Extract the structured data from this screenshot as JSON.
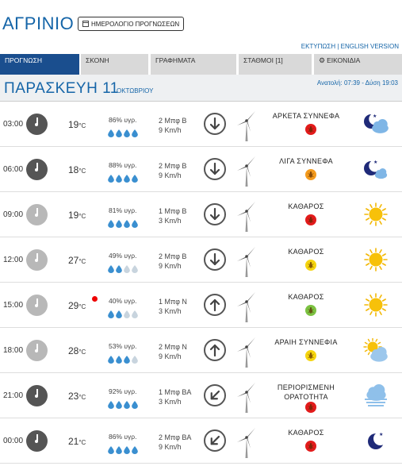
{
  "header": {
    "city": "ΑΓΡΙΝΙΟ",
    "calendar_button": "ΗΜΕΡΟΛΟΓΙΟ ΠΡΟΓΝΩΣΕΩΝ",
    "print_link": "ΕΚΤΥΠΩΣΗ",
    "separator": " | ",
    "english_link": "ENGLISH VERSION"
  },
  "tabs": [
    {
      "label": "ΠΡΟΓΝΩΣΗ",
      "active": true
    },
    {
      "label": "ΣΚΟΝΗ",
      "active": false
    },
    {
      "label": "ΓΡΑΦΗΜΑΤΑ",
      "active": false
    },
    {
      "label": "ΣΤΑΘΜΟΙ [1]",
      "active": false
    },
    {
      "label": "ΕΙΚΟΝΙΔΙΑ",
      "active": false
    }
  ],
  "date_bar": {
    "day": "ΠΑΡΑΣΚΕΥΗ 11",
    "month": "ΟΚΤΩΒΡΙΟΥ",
    "sun_times": "Ανατολή: 07:39 - Δύση 19:03"
  },
  "colors": {
    "accent": "#1565a8",
    "active_tab": "#1a4e8e",
    "tab_bg": "#d9d9d9",
    "drop_full": "#3a8fd0",
    "drop_empty": "#c8d4de",
    "bug_red": "#e21b1b",
    "bug_orange": "#f39a1d",
    "bug_yellow": "#f5d40f",
    "bug_green": "#7cc242"
  },
  "rows": [
    {
      "time": "03:00",
      "clock": "dark",
      "temp": "19",
      "unit": "°C",
      "hot": false,
      "humidity": "86% υγρ.",
      "drops": 4,
      "wind_force": "2 Μπφ Β",
      "wind_speed": "9 Km/h",
      "arrow": "down",
      "condition": "ΑΡΚΕΤΑ ΣΥΝΝΕΦΑ",
      "bug": "red",
      "icon": "moon-cloud-icon"
    },
    {
      "time": "06:00",
      "clock": "dark",
      "temp": "18",
      "unit": "°C",
      "hot": false,
      "humidity": "88% υγρ.",
      "drops": 4,
      "wind_force": "2 Μπφ Β",
      "wind_speed": "9 Km/h",
      "arrow": "down",
      "condition": "ΛΙΓΑ ΣΥΝΝΕΦΑ",
      "bug": "orange",
      "icon": "moon-small-cloud-icon"
    },
    {
      "time": "09:00",
      "clock": "light",
      "temp": "19",
      "unit": "°C",
      "hot": false,
      "humidity": "81% υγρ.",
      "drops": 4,
      "wind_force": "1 Μπφ Β",
      "wind_speed": "3 Km/h",
      "arrow": "down",
      "condition": "ΚΑΘΑΡΟΣ",
      "bug": "red",
      "icon": "sun-icon"
    },
    {
      "time": "12:00",
      "clock": "light",
      "temp": "27",
      "unit": "°C",
      "hot": false,
      "humidity": "49% υγρ.",
      "drops": 2,
      "wind_force": "2 Μπφ Β",
      "wind_speed": "9 Km/h",
      "arrow": "down",
      "condition": "ΚΑΘΑΡΟΣ",
      "bug": "yellow",
      "icon": "sun-icon"
    },
    {
      "time": "15:00",
      "clock": "light",
      "temp": "29",
      "unit": "°C",
      "hot": true,
      "humidity": "40% υγρ.",
      "drops": 2,
      "wind_force": "1 Μπφ Ν",
      "wind_speed": "3 Km/h",
      "arrow": "up",
      "condition": "ΚΑΘΑΡΟΣ",
      "bug": "green",
      "icon": "sun-icon"
    },
    {
      "time": "18:00",
      "clock": "light",
      "temp": "28",
      "unit": "°C",
      "hot": false,
      "humidity": "53% υγρ.",
      "drops": 3,
      "wind_force": "2 Μπφ Ν",
      "wind_speed": "9 Km/h",
      "arrow": "up",
      "condition": "ΑΡΑΙΗ ΣΥΝΝΕΦΙΑ",
      "bug": "yellow",
      "icon": "sun-cloud-icon"
    },
    {
      "time": "21:00",
      "clock": "dark",
      "temp": "23",
      "unit": "°C",
      "hot": false,
      "humidity": "92% υγρ.",
      "drops": 4,
      "wind_force": "1 Μπφ ΒΑ",
      "wind_speed": "3 Km/h",
      "arrow": "down-left",
      "condition": "ΠΕΡΙΟΡΙΣΜΕΝΗ ΟΡΑΤΟΤΗΤΑ",
      "bug": "red",
      "icon": "fog-icon"
    },
    {
      "time": "00:00",
      "clock": "dark",
      "temp": "21",
      "unit": "°C",
      "hot": false,
      "humidity": "86% υγρ.",
      "drops": 4,
      "wind_force": "2 Μπφ ΒΑ",
      "wind_speed": "9 Km/h",
      "arrow": "down-left",
      "condition": "ΚΑΘΑΡΟΣ",
      "bug": "red",
      "icon": "moon-icon"
    }
  ]
}
